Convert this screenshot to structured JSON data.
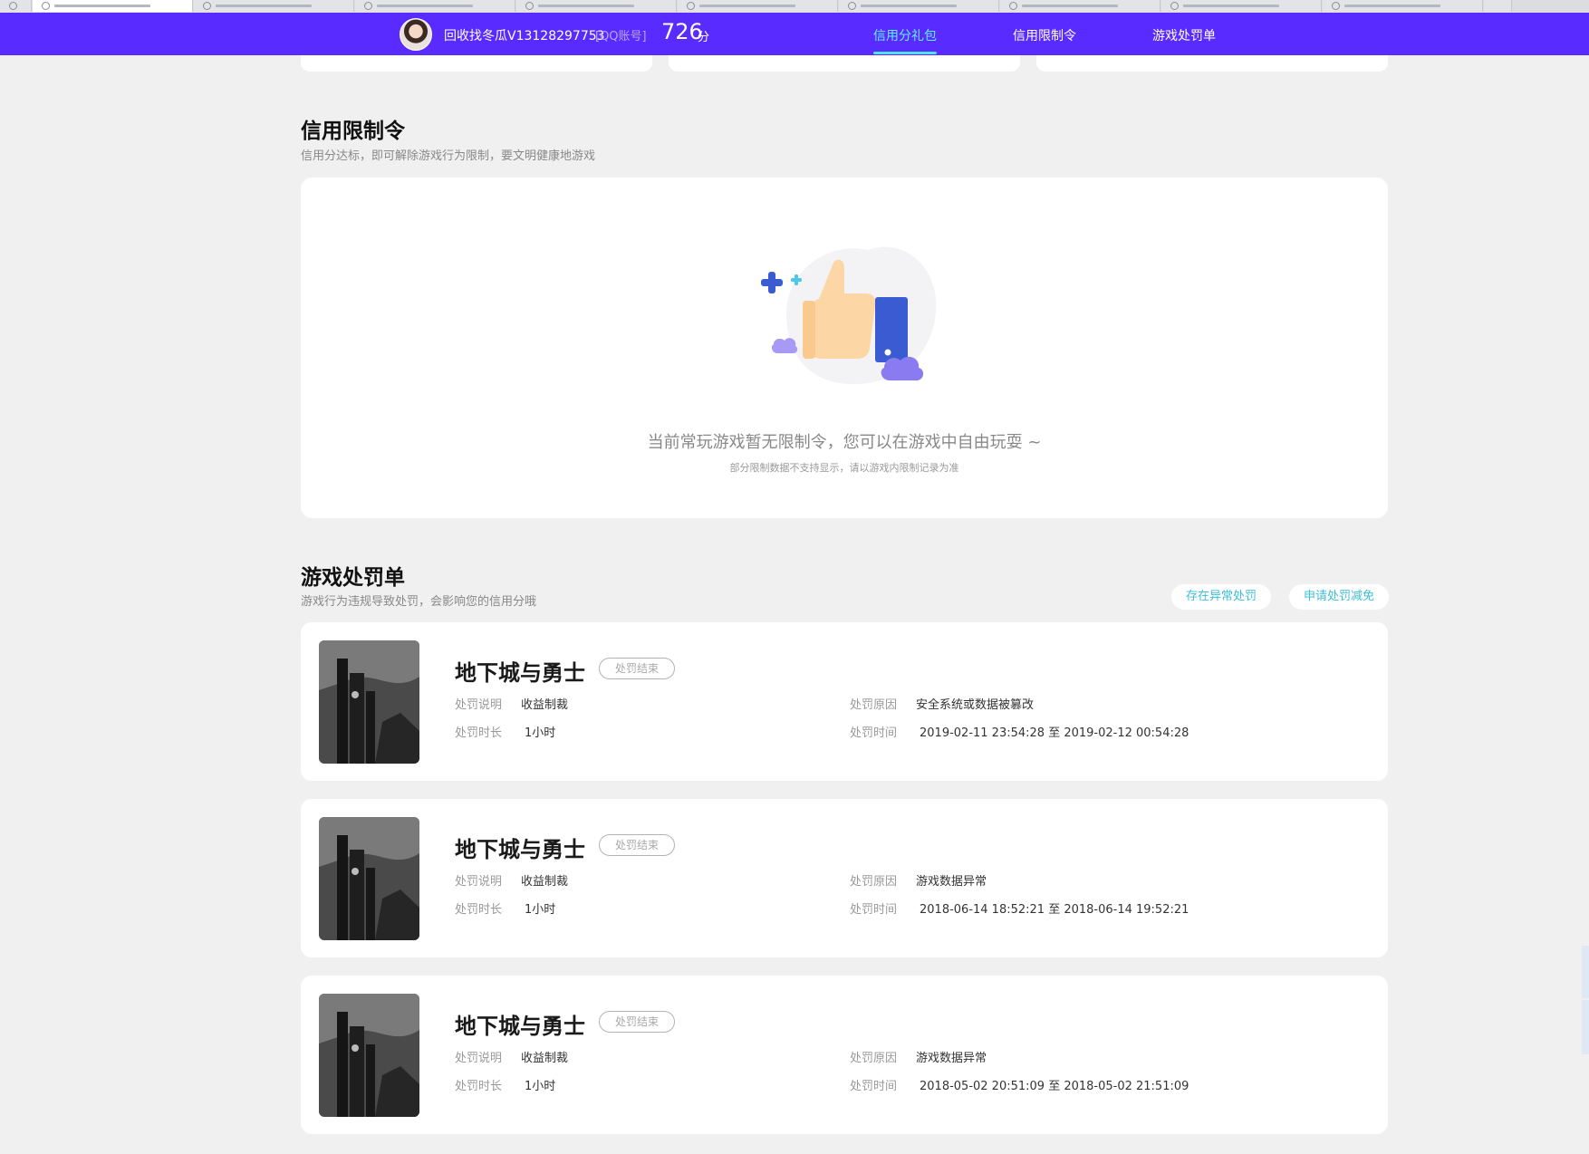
{
  "header": {
    "username": "回收找冬瓜V13128297753",
    "account_type": "[QQ账号]",
    "score": "726",
    "score_unit": "分",
    "tabs": [
      {
        "label": "信用分礼包",
        "active": true
      },
      {
        "label": "信用限制令",
        "active": false
      },
      {
        "label": "游戏处罚单",
        "active": false
      }
    ]
  },
  "restriction": {
    "title": "信用限制令",
    "subtitle": "信用分达标，即可解除游戏行为限制，要文明健康地游戏",
    "empty_message": "当前常玩游戏暂无限制令，您可以在游戏中自由玩耍 ~",
    "empty_note": "部分限制数据不支持显示，请以游戏内限制记录为准"
  },
  "penalty": {
    "title": "游戏处罚单",
    "subtitle": "游戏行为违规导致处罚，会影响您的信用分哦",
    "buttons": {
      "abnormal": "存在异常处罚",
      "reduce": "申请处罚减免"
    },
    "field_labels": {
      "desc": "处罚说明",
      "duration": "处罚时长",
      "reason": "处罚原因",
      "time": "处罚时间"
    },
    "items": [
      {
        "game": "地下城与勇士",
        "status": "处罚结束",
        "desc": "收益制裁",
        "duration": "1小时",
        "reason": "安全系统或数据被篡改",
        "time": "2019-02-11 23:54:28 至 2019-02-12 00:54:28"
      },
      {
        "game": "地下城与勇士",
        "status": "处罚结束",
        "desc": "收益制裁",
        "duration": "1小时",
        "reason": "游戏数据异常",
        "time": "2018-06-14 18:52:21 至 2018-06-14 19:52:21"
      },
      {
        "game": "地下城与勇士",
        "status": "处罚结束",
        "desc": "收益制裁",
        "duration": "1小时",
        "reason": "游戏数据异常",
        "time": "2018-05-02 20:51:09 至 2018-05-02 21:51:09"
      }
    ]
  },
  "colors": {
    "header_bg": "#5a2bff",
    "active_tab": "#60f0ff",
    "accent": "#3bbfd8"
  }
}
